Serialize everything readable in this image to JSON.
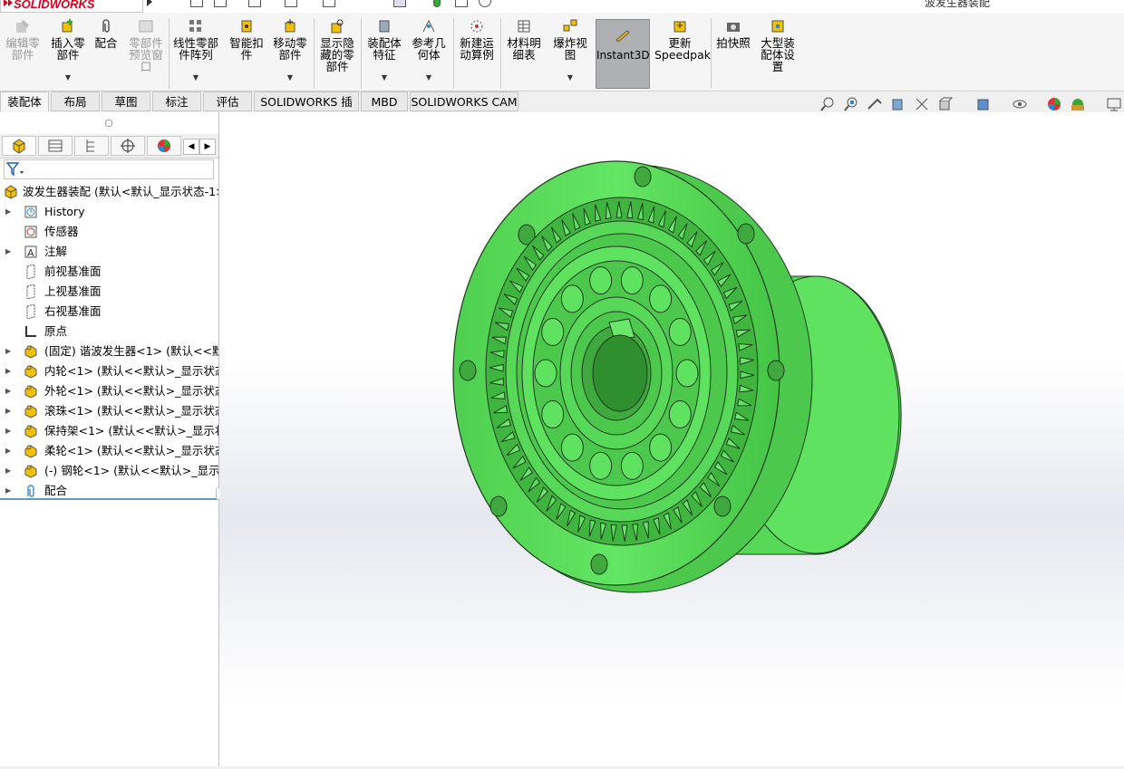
{
  "app": {
    "brand": "SOLIDWORKS",
    "window_title": "波发生器装配"
  },
  "ribbon": {
    "buttons": [
      {
        "id": "edit_component",
        "label": "编辑零\n部件",
        "disabled": true
      },
      {
        "id": "insert_component",
        "label": "插入零\n部件",
        "disabled": false
      },
      {
        "id": "mate",
        "label": "配合",
        "disabled": false
      },
      {
        "id": "component_preview",
        "label": "零部件\n预览窗\n口",
        "disabled": true
      },
      {
        "id": "linear_pattern",
        "label": "线性零部\n件阵列",
        "disabled": false
      },
      {
        "id": "smart_fasteners",
        "label": "智能扣\n件",
        "disabled": false
      },
      {
        "id": "move_component",
        "label": "移动零\n部件",
        "disabled": false
      },
      {
        "id": "show_hidden",
        "label": "显示隐\n藏的零\n部件",
        "disabled": false
      },
      {
        "id": "assembly_features",
        "label": "装配体\n特征",
        "disabled": false
      },
      {
        "id": "reference_geometry",
        "label": "参考几\n何体",
        "disabled": false
      },
      {
        "id": "new_motion_study",
        "label": "新建运\n动算例",
        "disabled": false
      },
      {
        "id": "bill_of_materials",
        "label": "材料明\n细表",
        "disabled": false
      },
      {
        "id": "exploded_view",
        "label": "爆炸视\n图",
        "disabled": false
      },
      {
        "id": "instant3d",
        "label": "Instant3D",
        "disabled": false
      },
      {
        "id": "update_speedpak",
        "label": "更新\nSpeedpak",
        "disabled": false
      },
      {
        "id": "take_snapshot",
        "label": "拍快照",
        "disabled": false
      },
      {
        "id": "large_assembly",
        "label": "大型装\n配体设\n置",
        "disabled": false
      }
    ]
  },
  "tabs": [
    "装配体",
    "布局",
    "草图",
    "标注",
    "评估",
    "SOLIDWORKS 插件",
    "MBD",
    "SOLIDWORKS CAM"
  ],
  "tree": {
    "root": "波发生器装配  (默认<默认_显示状态-1>",
    "items": [
      {
        "label": "History",
        "icon": "history-icon",
        "expandable": true
      },
      {
        "label": "传感器",
        "icon": "sensor-icon",
        "expandable": false
      },
      {
        "label": "注解",
        "icon": "annotation-icon",
        "expandable": true
      },
      {
        "label": "前视基准面",
        "icon": "plane-icon",
        "expandable": false
      },
      {
        "label": "上视基准面",
        "icon": "plane-icon",
        "expandable": false
      },
      {
        "label": "右视基准面",
        "icon": "plane-icon",
        "expandable": false
      },
      {
        "label": "原点",
        "icon": "origin-icon",
        "expandable": false
      },
      {
        "label": "(固定) 谐波发生器<1> (默认<<默认",
        "icon": "component-icon",
        "expandable": true
      },
      {
        "label": "内轮<1> (默认<<默认>_显示状态",
        "icon": "component-icon",
        "expandable": true
      },
      {
        "label": "外轮<1> (默认<<默认>_显示状态",
        "icon": "component-icon",
        "expandable": true
      },
      {
        "label": "滚珠<1> (默认<<默认>_显示状态",
        "icon": "component-icon",
        "expandable": true
      },
      {
        "label": "保持架<1> (默认<<默认>_显示状态",
        "icon": "component-icon",
        "expandable": true
      },
      {
        "label": "柔轮<1> (默认<<默认>_显示状态",
        "icon": "component-icon",
        "expandable": true
      },
      {
        "label": "(-) 钢轮<1> (默认<<默认>_显示状",
        "icon": "component-icon",
        "expandable": true
      },
      {
        "label": "配合",
        "icon": "mates-icon",
        "expandable": true
      }
    ]
  },
  "model": {
    "color": "#5fe25f",
    "edge": "#1f3a1f"
  }
}
